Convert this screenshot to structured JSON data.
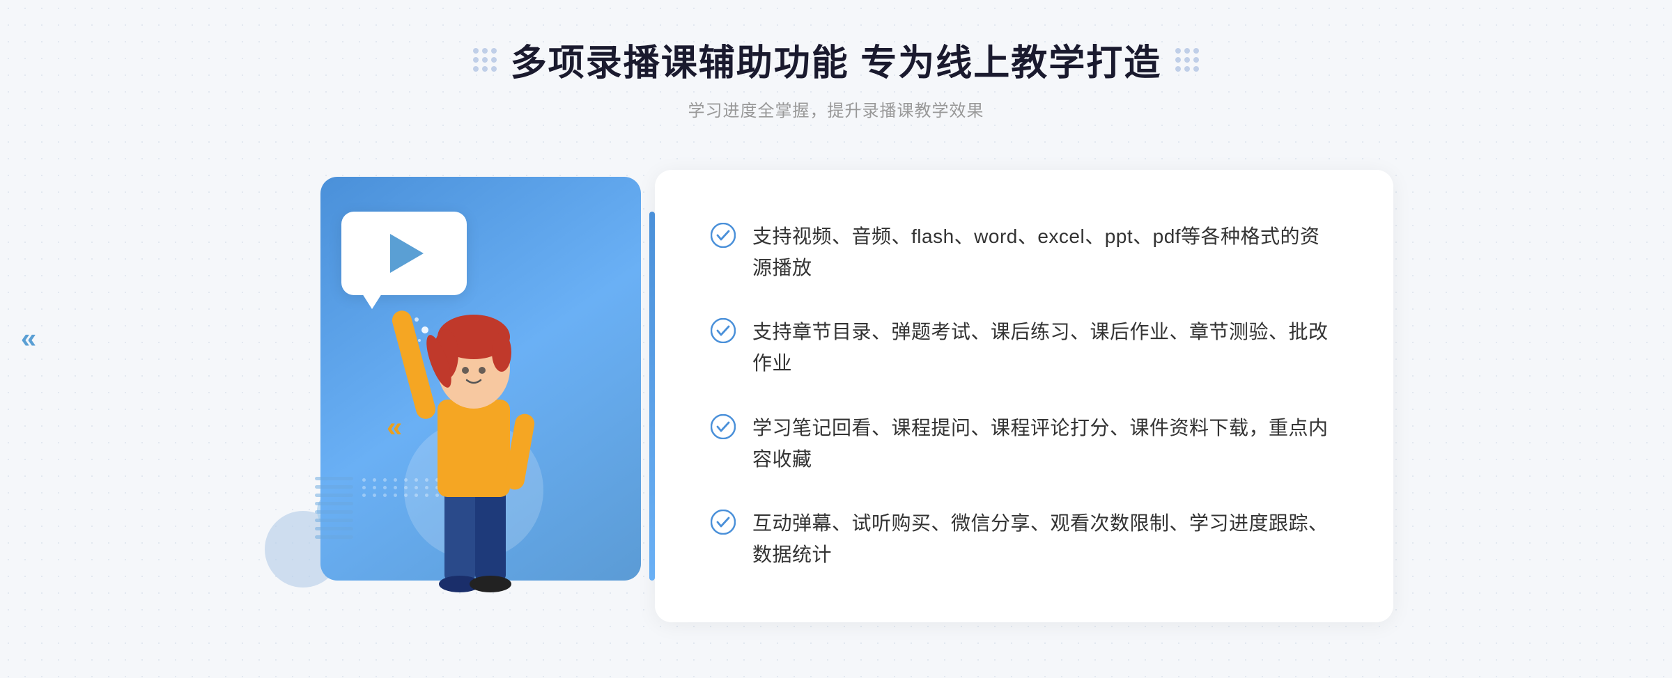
{
  "page": {
    "bg_color": "#f5f7fa"
  },
  "header": {
    "title": "多项录播课辅助功能 专为线上教学打造",
    "subtitle": "学习进度全掌握，提升录播课教学效果",
    "deco_left": "decorative-dots-left",
    "deco_right": "decorative-dots-right"
  },
  "features": [
    {
      "id": 1,
      "text": "支持视频、音频、flash、word、excel、ppt、pdf等各种格式的资源播放"
    },
    {
      "id": 2,
      "text": "支持章节目录、弹题考试、课后练习、课后作业、章节测验、批改作业"
    },
    {
      "id": 3,
      "text": "学习笔记回看、课程提问、课程评论打分、课件资料下载，重点内容收藏"
    },
    {
      "id": 4,
      "text": "互动弹幕、试听购买、微信分享、观看次数限制、学习进度跟踪、数据统计"
    }
  ],
  "icons": {
    "check": "✓",
    "play": "▶",
    "left_arrows": "«",
    "deco_color": "#4a90d9"
  }
}
